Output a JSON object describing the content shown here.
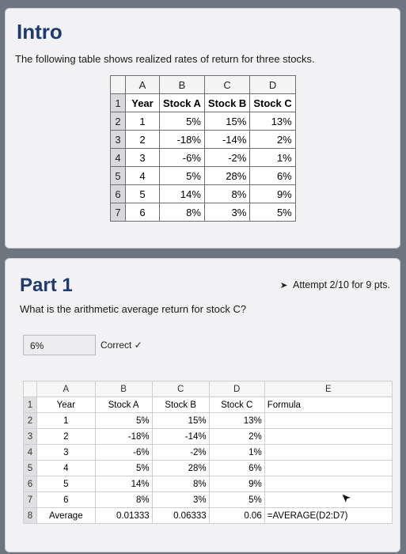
{
  "intro": {
    "title": "Intro",
    "description": "The following table shows realized rates of return for three stocks.",
    "columns": [
      "A",
      "B",
      "C",
      "D"
    ],
    "rows": [
      {
        "n": "1",
        "cells": [
          "Year",
          "Stock A",
          "Stock B",
          "Stock C"
        ]
      },
      {
        "n": "2",
        "cells": [
          "1",
          "5%",
          "15%",
          "13%"
        ]
      },
      {
        "n": "3",
        "cells": [
          "2",
          "-18%",
          "-14%",
          "2%"
        ]
      },
      {
        "n": "4",
        "cells": [
          "3",
          "-6%",
          "-2%",
          "1%"
        ]
      },
      {
        "n": "5",
        "cells": [
          "4",
          "5%",
          "28%",
          "6%"
        ]
      },
      {
        "n": "6",
        "cells": [
          "5",
          "14%",
          "8%",
          "9%"
        ]
      },
      {
        "n": "7",
        "cells": [
          "6",
          "8%",
          "3%",
          "5%"
        ]
      }
    ]
  },
  "part1": {
    "title": "Part 1",
    "attempt": "Attempt 2/10 for 9 pts.",
    "question": "What is the arithmetic average return for stock C?",
    "answer_value": "6%",
    "status": "Correct ✓",
    "sheet": {
      "columns": [
        "A",
        "B",
        "C",
        "D",
        "E"
      ],
      "rows": [
        {
          "n": "1",
          "cells": [
            "Year",
            "Stock A",
            "Stock B",
            "Stock C",
            "Formula"
          ]
        },
        {
          "n": "2",
          "cells": [
            "1",
            "5%",
            "15%",
            "13%",
            ""
          ]
        },
        {
          "n": "3",
          "cells": [
            "2",
            "-18%",
            "-14%",
            "2%",
            ""
          ]
        },
        {
          "n": "4",
          "cells": [
            "3",
            "-6%",
            "-2%",
            "1%",
            ""
          ]
        },
        {
          "n": "5",
          "cells": [
            "4",
            "5%",
            "28%",
            "6%",
            ""
          ]
        },
        {
          "n": "6",
          "cells": [
            "5",
            "14%",
            "8%",
            "9%",
            ""
          ]
        },
        {
          "n": "7",
          "cells": [
            "6",
            "8%",
            "3%",
            "5%",
            ""
          ]
        },
        {
          "n": "8",
          "cells": [
            "Average",
            "0.01333",
            "0.06333",
            "0.06",
            "=AVERAGE(D2:D7)"
          ]
        }
      ]
    }
  },
  "icons": {
    "attempt": "flag-icon",
    "cursor": "mouse-pointer-icon"
  }
}
